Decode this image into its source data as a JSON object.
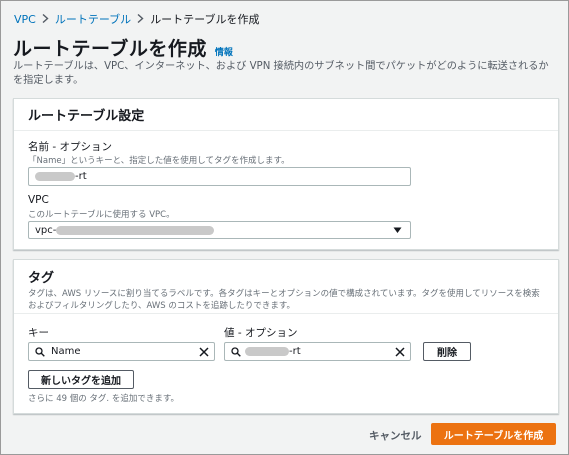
{
  "breadcrumb": {
    "items": [
      "VPC",
      "ルートテーブル",
      "ルートテーブルを作成"
    ]
  },
  "page": {
    "title": "ルートテーブルを作成",
    "info": "情報",
    "description": "ルートテーブルは、VPC、インターネット、および VPN 接続内のサブネット間でパケットがどのように転送されるかを指定します。"
  },
  "settings": {
    "title": "ルートテーブル設定",
    "name_label": "名前 - オプション",
    "name_desc": "「Name」というキーと、指定した値を使用してタグを作成します。",
    "name_value_suffix": "-rt",
    "vpc_label": "VPC",
    "vpc_desc": "このルートテーブルに使用する VPC。",
    "vpc_value_prefix": "vpc-"
  },
  "tags": {
    "title": "タグ",
    "desc": "タグは、AWS リソースに割り当てるラベルです。各タグはキーとオプションの値で構成されています。タグを使用してリソースを検索およびフィルタリングしたり、AWS のコストを追跡したりできます。",
    "key_label": "キー",
    "value_label": "値 - オプション",
    "key_value": "Name",
    "value_suffix": "-rt",
    "remove_label": "削除",
    "add_label": "新しいタグを追加",
    "remaining": "さらに 49 個の タグ. を追加できます。"
  },
  "footer": {
    "cancel_label": "キャンセル",
    "create_label": "ルートテーブルを作成"
  },
  "colors": {
    "accent": "#ec7211",
    "link": "#0073bb"
  }
}
